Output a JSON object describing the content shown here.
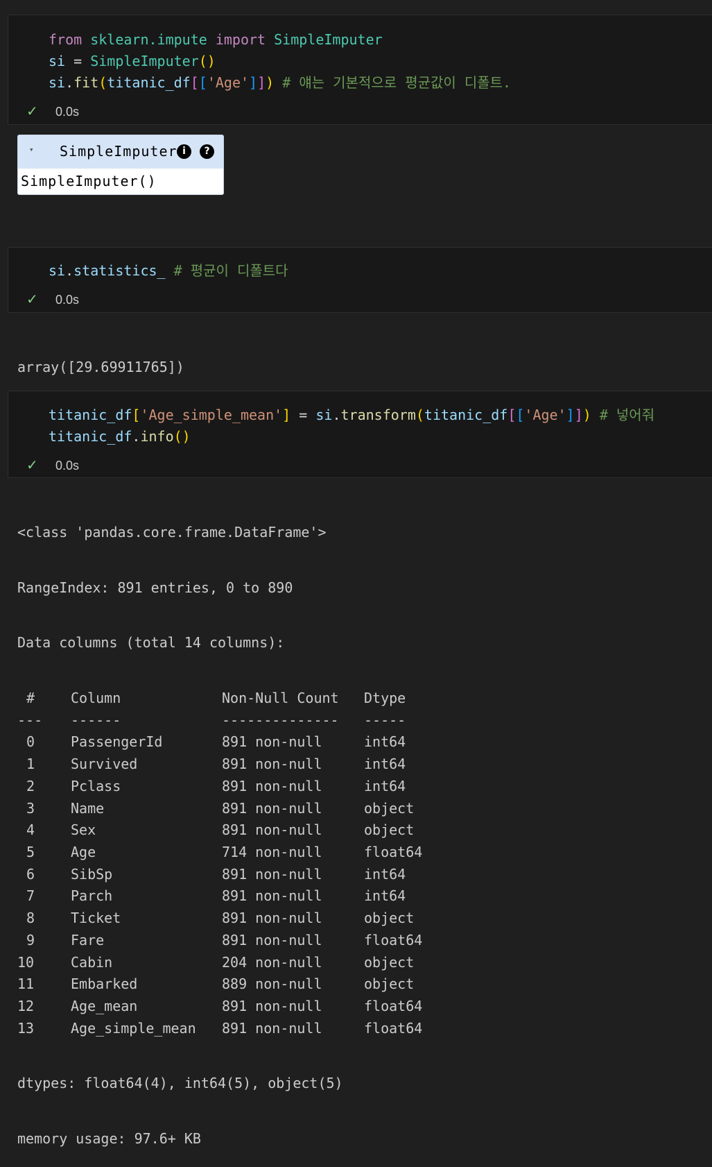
{
  "cell1": {
    "code": {
      "kw_from": "from",
      "module": "sklearn.impute",
      "kw_import": "import",
      "class_name": "SimpleImputer",
      "line2_var": "si",
      "line2_eq": " = ",
      "line2_call": "SimpleImputer",
      "line2_parens": "()",
      "line3_var": "si",
      "line3_dot": ".",
      "line3_fn": "fit",
      "line3_open": "(",
      "line3_arg": "titanic_df",
      "line3_b2o": "[",
      "line3_b3o": "[",
      "line3_str": "'Age'",
      "line3_b3c": "]",
      "line3_b2c": "]",
      "line3_close": ")",
      "line3_comment": "# 얘는 기본적으로 평균값이 디폴트."
    },
    "status": "0.0s"
  },
  "estimator": {
    "header": "SimpleImputer",
    "arrow": "▾",
    "info_icon": "i",
    "help_icon": "?",
    "body": "SimpleImputer()"
  },
  "cell2": {
    "code": {
      "var": "si",
      "dot": ".",
      "attr": "statistics_",
      "comment": "# 평균이 디폴트다"
    },
    "status": "0.0s",
    "output": "array([29.69911765])"
  },
  "cell3": {
    "code": {
      "l1_var": "titanic_df",
      "l1_b1o": "[",
      "l1_str": "'Age_simple_mean'",
      "l1_b1c": "]",
      "l1_eq": " = ",
      "l1_var2": "si",
      "l1_dot": ".",
      "l1_fn": "transform",
      "l1_open": "(",
      "l1_arg": "titanic_df",
      "l1_b2o": "[",
      "l1_b3o": "[",
      "l1_str2": "'Age'",
      "l1_b3c": "]",
      "l1_b2c": "]",
      "l1_close": ")",
      "l1_comment": "# 넣어줘",
      "l2_var": "titanic_df",
      "l2_dot": ".",
      "l2_fn": "info",
      "l2_parens": "()"
    },
    "status": "0.0s"
  },
  "info_output": {
    "class_line": "<class 'pandas.core.frame.DataFrame'>",
    "range_line": "RangeIndex: 891 entries, 0 to 890",
    "columns_line": "Data columns (total 14 columns):",
    "header": [
      "#",
      "Column",
      "Non-Null Count",
      "Dtype"
    ],
    "separator": [
      "---",
      "------",
      "--------------",
      "-----"
    ],
    "rows": [
      [
        "0",
        "PassengerId",
        "891 non-null",
        "int64"
      ],
      [
        "1",
        "Survived",
        "891 non-null",
        "int64"
      ],
      [
        "2",
        "Pclass",
        "891 non-null",
        "int64"
      ],
      [
        "3",
        "Name",
        "891 non-null",
        "object"
      ],
      [
        "4",
        "Sex",
        "891 non-null",
        "object"
      ],
      [
        "5",
        "Age",
        "714 non-null",
        "float64"
      ],
      [
        "6",
        "SibSp",
        "891 non-null",
        "int64"
      ],
      [
        "7",
        "Parch",
        "891 non-null",
        "int64"
      ],
      [
        "8",
        "Ticket",
        "891 non-null",
        "object"
      ],
      [
        "9",
        "Fare",
        "891 non-null",
        "float64"
      ],
      [
        "10",
        "Cabin",
        "204 non-null",
        "object"
      ],
      [
        "11",
        "Embarked",
        "889 non-null",
        "object"
      ],
      [
        "12",
        "Age_mean",
        "891 non-null",
        "float64"
      ],
      [
        "13",
        "Age_simple_mean",
        "891 non-null",
        "float64"
      ]
    ],
    "dtypes_line": "dtypes: float64(4), int64(5), object(5)",
    "memory_line": "memory usage: 97.6+ KB"
  }
}
